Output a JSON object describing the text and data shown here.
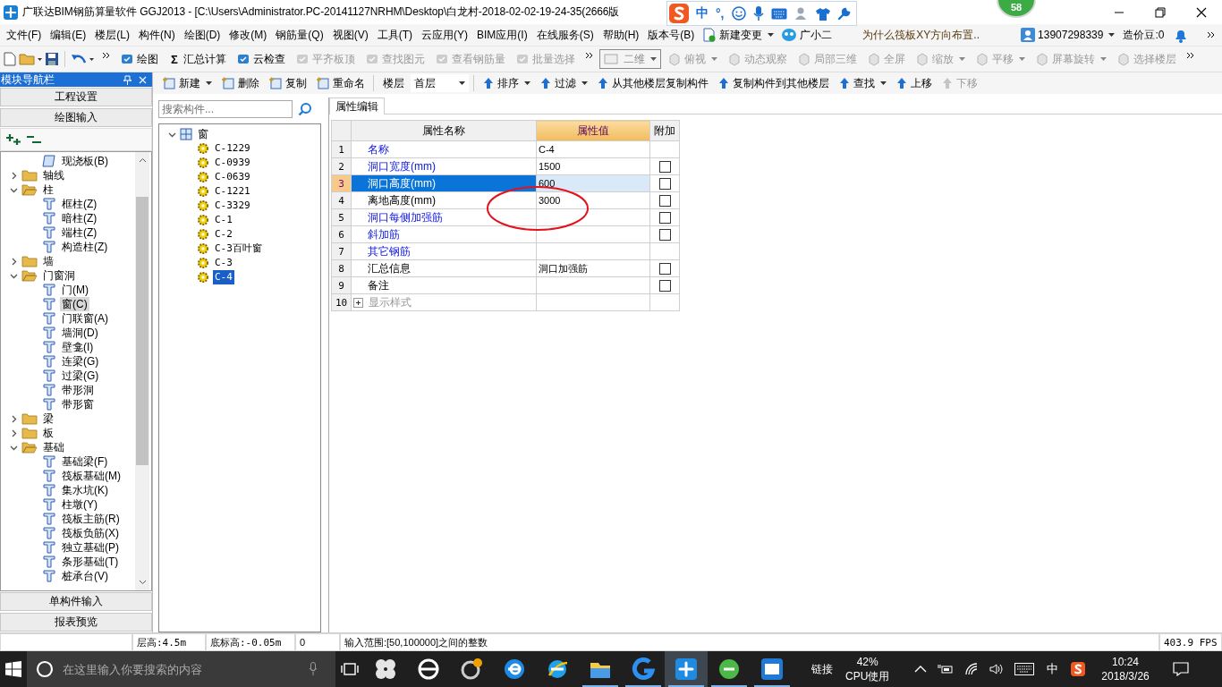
{
  "window": {
    "title": "广联达BIM钢筋算量软件 GGJ2013 - [C:\\Users\\Administrator.PC-20141127NRHM\\Desktop\\白龙村-2018-02-02-19-24-35(2666版"
  },
  "ime_bar": {
    "lang": "中",
    "punct": "°,"
  },
  "badge": "58",
  "menu": [
    "文件(F)",
    "编辑(E)",
    "楼层(L)",
    "构件(N)",
    "绘图(D)",
    "修改(M)",
    "钢筋量(Q)",
    "视图(V)",
    "工具(T)",
    "云应用(Y)",
    "BIM应用(I)",
    "在线服务(S)",
    "帮助(H)",
    "版本号(B)"
  ],
  "menu_extras": {
    "new_change": "新建变更",
    "assistant": "广小二",
    "question": "为什么筏板XY方向布置..",
    "account": "13907298339",
    "beans": "造价豆:0"
  },
  "toolbar": [
    {
      "label": "绘图",
      "disabled": false
    },
    {
      "label": "汇总计算",
      "glyph": "Σ",
      "disabled": false
    },
    {
      "label": "云检查",
      "disabled": false
    },
    {
      "label": "平齐板顶",
      "disabled": true
    },
    {
      "label": "查找图元",
      "disabled": true
    },
    {
      "label": "查看钢筋量",
      "disabled": true
    },
    {
      "label": "批量选择",
      "disabled": true
    }
  ],
  "view_select": "二维",
  "view_tools": [
    {
      "label": "俯视",
      "dropdown": true
    },
    {
      "label": "动态观察",
      "dropdown": false
    },
    {
      "label": "局部三维",
      "dropdown": false
    },
    {
      "label": "全屏",
      "dropdown": false
    },
    {
      "label": "缩放",
      "dropdown": true
    },
    {
      "label": "平移",
      "dropdown": true
    },
    {
      "label": "屏幕旋转",
      "dropdown": true
    },
    {
      "label": "选择楼层",
      "dropdown": false
    }
  ],
  "nav": {
    "title": "模块导航栏",
    "sections": [
      "工程设置",
      "绘图输入"
    ],
    "bottom_sections": [
      "单构件输入",
      "报表预览"
    ],
    "tree": {
      "partial_children": [
        {
          "label": "现浇板(B)",
          "selected": false
        }
      ],
      "items": [
        {
          "label": "轴线",
          "expanded": false,
          "selected": false
        },
        {
          "label": "柱",
          "expanded": true,
          "selected": false,
          "children": [
            {
              "label": "框柱(Z)",
              "selected": false
            },
            {
              "label": "暗柱(Z)",
              "selected": false
            },
            {
              "label": "端柱(Z)",
              "selected": false
            },
            {
              "label": "构造柱(Z)",
              "selected": false
            }
          ]
        },
        {
          "label": "墙",
          "expanded": false,
          "selected": false
        },
        {
          "label": "门窗洞",
          "expanded": true,
          "selected": false,
          "children": [
            {
              "label": "门(M)",
              "selected": false
            },
            {
              "label": "窗(C)",
              "selected": true
            },
            {
              "label": "门联窗(A)",
              "selected": false
            },
            {
              "label": "墙洞(D)",
              "selected": false
            },
            {
              "label": "壁龛(I)",
              "selected": false
            },
            {
              "label": "连梁(G)",
              "selected": false
            },
            {
              "label": "过梁(G)",
              "selected": false
            },
            {
              "label": "带形洞",
              "selected": false
            },
            {
              "label": "带形窗",
              "selected": false
            }
          ]
        },
        {
          "label": "梁",
          "expanded": false,
          "selected": false
        },
        {
          "label": "板",
          "expanded": false,
          "selected": false
        },
        {
          "label": "基础",
          "expanded": true,
          "selected": false,
          "children": [
            {
              "label": "基础梁(F)",
              "selected": false
            },
            {
              "label": "筏板基础(M)",
              "selected": false
            },
            {
              "label": "集水坑(K)",
              "selected": false
            },
            {
              "label": "柱墩(Y)",
              "selected": false
            },
            {
              "label": "筏板主筋(R)",
              "selected": false
            },
            {
              "label": "筏板负筋(X)",
              "selected": false
            },
            {
              "label": "独立基础(P)",
              "selected": false
            },
            {
              "label": "条形基础(T)",
              "selected": false
            },
            {
              "label": "桩承台(V)",
              "selected": false
            }
          ]
        }
      ]
    }
  },
  "edit_toolbar": {
    "left": [
      {
        "label": "新建",
        "dropdown": true
      },
      {
        "label": "删除",
        "dropdown": false
      },
      {
        "label": "复制",
        "dropdown": false
      },
      {
        "label": "重命名",
        "dropdown": false
      }
    ],
    "floor": {
      "label": "楼层",
      "value": "首层"
    },
    "right": [
      {
        "label": "排序",
        "dropdown": true,
        "disabled": false
      },
      {
        "label": "过滤",
        "dropdown": true,
        "disabled": false
      },
      {
        "label": "从其他楼层复制构件",
        "dropdown": false,
        "disabled": false
      },
      {
        "label": "复制构件到其他楼层",
        "dropdown": false,
        "disabled": false
      },
      {
        "label": "查找",
        "dropdown": true,
        "disabled": false
      },
      {
        "label": "上移",
        "dropdown": false,
        "disabled": false
      },
      {
        "label": "下移",
        "dropdown": false,
        "disabled": true
      }
    ]
  },
  "components": {
    "search_placeholder": "搜索构件...",
    "tree": {
      "label": "窗",
      "expanded": true,
      "children": [
        {
          "label": "C-1229",
          "selected": false
        },
        {
          "label": "C-0939",
          "selected": false
        },
        {
          "label": "C-0639",
          "selected": false
        },
        {
          "label": "C-1221",
          "selected": false
        },
        {
          "label": "C-3329",
          "selected": false
        },
        {
          "label": "C-1",
          "selected": false
        },
        {
          "label": "C-2",
          "selected": false
        },
        {
          "label": "C-3百叶窗",
          "selected": false
        },
        {
          "label": "C-3",
          "selected": false
        },
        {
          "label": "C-4",
          "selected": true
        }
      ]
    }
  },
  "properties": {
    "tab": "属性编辑",
    "columns": [
      "属性名称",
      "属性值",
      "附加"
    ],
    "rows": [
      {
        "index": "1",
        "name": "名称",
        "kind": "link",
        "value": "C-4",
        "selected": false
      },
      {
        "index": "2",
        "name": "洞口宽度(mm)",
        "kind": "link",
        "value": "1500",
        "checked": false,
        "selected": false
      },
      {
        "index": "3",
        "name": "洞口高度(mm)",
        "kind": "link",
        "value": "600",
        "checked": false,
        "selected": true
      },
      {
        "index": "4",
        "name": "离地高度(mm)",
        "kind": "plain",
        "value": "3000",
        "checked": false,
        "selected": false
      },
      {
        "index": "5",
        "name": "洞口每侧加强筋",
        "kind": "link",
        "checked": false,
        "selected": false
      },
      {
        "index": "6",
        "name": "斜加筋",
        "kind": "link",
        "checked": false,
        "selected": false
      },
      {
        "index": "7",
        "name": "其它钢筋",
        "kind": "link",
        "selected": false
      },
      {
        "index": "8",
        "name": "汇总信息",
        "kind": "plain",
        "value": "洞口加强筋",
        "checked": false,
        "selected": false
      },
      {
        "index": "9",
        "name": "备注",
        "kind": "plain",
        "checked": false,
        "selected": false
      },
      {
        "index": "10",
        "name": "显示样式",
        "kind": "group",
        "expanded": false,
        "selected": false
      }
    ]
  },
  "status_bar": {
    "cells": [
      "层高:4.5m",
      "底标高:-0.05m",
      "0",
      "输入范围:[50,100000]之间的整数"
    ],
    "fps": "403.9 FPS"
  },
  "taskbar": {
    "search_placeholder": "在这里输入你要搜索的内容",
    "apps": [
      {
        "running": false,
        "active": false
      },
      {
        "running": false,
        "active": false
      },
      {
        "running": false,
        "active": false
      },
      {
        "running": false,
        "active": false
      },
      {
        "running": false,
        "active": false
      },
      {
        "running": true,
        "active": false
      },
      {
        "running": true,
        "active": false
      },
      {
        "running": true,
        "active": true
      },
      {
        "running": true,
        "active": false
      },
      {
        "running": true,
        "active": false
      }
    ],
    "links": "链接",
    "cpu": "42%",
    "cpu_label": "CPU使用",
    "lang": "中",
    "time": "10:24",
    "date": "2018/3/26"
  }
}
